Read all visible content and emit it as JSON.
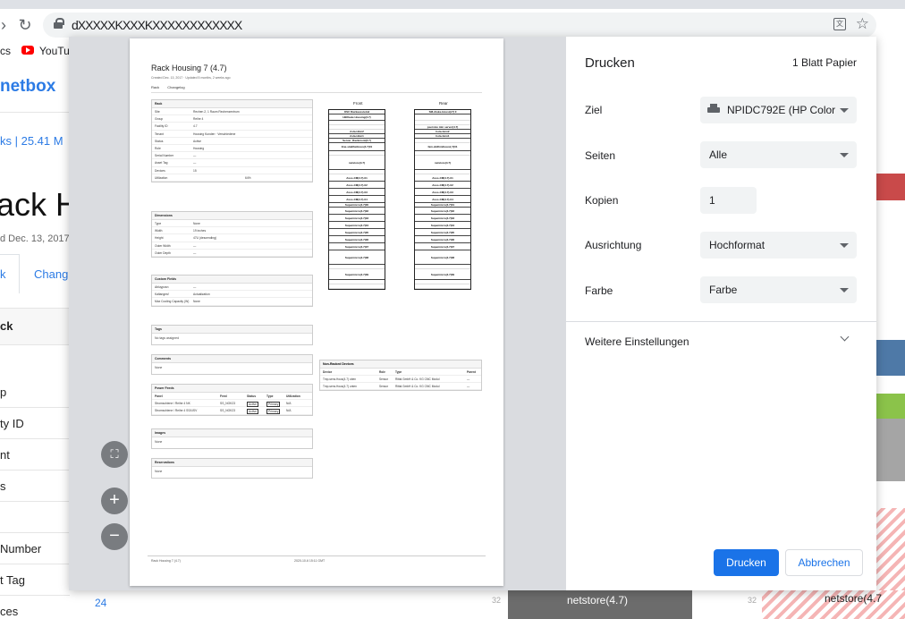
{
  "browser": {
    "url": "dXXXXXKXXXKXXXXXXXXXXXX",
    "bookmarks": [
      "cs",
      "YouTub"
    ]
  },
  "background": {
    "brand": "netbox",
    "breadcrumb": "ks  |  25.41 M",
    "title": "ack Ho",
    "subtitle": "d Dec. 13, 2017 ·",
    "tab_rack": "k",
    "tab_changelog": "Chang",
    "panel_title": "ck",
    "rows": [
      "p",
      "ty ID",
      "nt",
      "s",
      "",
      "Number",
      "t Tag",
      "ces"
    ],
    "row_value": "24",
    "bottom_num1": "32",
    "bottom_block": "netstore(4.7)",
    "bottom_num2": "32",
    "bottom_stripe": "netstore(4.7"
  },
  "dialog": {
    "title": "Drucken",
    "sheets": "1 Blatt Papier",
    "fields": {
      "destination_label": "Ziel",
      "destination_value": "NPIDC792E (HP Color",
      "pages_label": "Seiten",
      "pages_value": "Alle",
      "copies_label": "Kopien",
      "copies_value": "1",
      "orientation_label": "Ausrichtung",
      "orientation_value": "Hochformat",
      "color_label": "Farbe",
      "color_value": "Farbe"
    },
    "more_settings": "Weitere Einstellungen",
    "print_button": "Drucken",
    "cancel_button": "Abbrechen",
    "fit_icon": "fit-to-page-icon",
    "zoom_in": "+",
    "zoom_out": "−"
  },
  "preview": {
    "title": "Rack Housing 7 (4.7)",
    "subtitle": "Created Dec. 13, 2017 · Updated 5 months, 2 weeks ago",
    "tabs": [
      "Rack",
      "Changelog"
    ],
    "rack_panel": {
      "title": "Rack",
      "rows": [
        [
          "Site",
          "Rechen 2, 1 Raum Rechenzentrum",
          ""
        ],
        [
          "Group",
          "Reihe 4",
          ""
        ],
        [
          "Facility ID",
          "4.7",
          ""
        ],
        [
          "Tenant",
          "Housing Kunden · Verschiedene",
          ""
        ],
        [
          "Status",
          "Active",
          ""
        ],
        [
          "Role",
          "Housing",
          ""
        ],
        [
          "Serial Number",
          "—",
          ""
        ],
        [
          "Asset Tag",
          "—",
          ""
        ],
        [
          "Devices",
          "15",
          ""
        ],
        [
          "Utilization",
          "",
          "64%"
        ]
      ]
    },
    "dimensions_panel": {
      "title": "Dimensions",
      "rows": [
        [
          "Type",
          "None",
          ""
        ],
        [
          "Width",
          "19 inches",
          ""
        ],
        [
          "Height",
          "47U (descending)",
          ""
        ],
        [
          "Outer Width",
          "—",
          ""
        ],
        [
          "Outer Depth",
          "—",
          ""
        ]
      ]
    },
    "custom_panel": {
      "title": "Custom Fields",
      "rows": [
        [
          "Abluyposn",
          "—",
          ""
        ],
        [
          "Kaltangesf",
          "Actualization",
          ""
        ],
        [
          "Max Cooling Capacity (W)",
          "None",
          ""
        ]
      ]
    },
    "tags_panel": {
      "title": "Tags",
      "body": "No tags assigned"
    },
    "comments_panel": {
      "title": "Comments",
      "body": "None"
    },
    "power_panel": {
      "title": "Power Feeds",
      "headers": [
        "Panel",
        "Feed",
        "Status",
        "Type",
        "Utilization"
      ],
      "rows": [
        [
          "Stromschiene / Reihe 4 NK",
          "SS_NOK23",
          "Active",
          "Primary",
          "N/A"
        ],
        [
          "Stromschiene / Reihe 4 SS/USV",
          "SS_NOK23",
          "Active",
          "Primary",
          "N/A"
        ]
      ]
    },
    "images_panel": {
      "title": "Images",
      "body": "None"
    },
    "reservations_panel": {
      "title": "Reservations",
      "body": "None"
    },
    "front_label": "Front",
    "rear_label": "Rear",
    "front_units": [
      "OSC Rackaussteind",
      "HERsate Housing(4.7)",
      "",
      "",
      "Asla-Hmn2",
      "Asla-Hmn1",
      "Server_Rackmont(4.7)",
      "Ene-staBhsiHous(4.7)01",
      "",
      "netstore(4.7)",
      "",
      "Axos-CM(4.7)-01",
      "Axos-CM(4.7)-02",
      "Axos-CM(4.7)-03",
      "Axos-CM(4.7)-04",
      "Supermicro(4.7)00",
      "Supermicro(4.7)02",
      "Supermicro(4.7)03",
      "Supermicro(4.7)04",
      "Supermicro(4.7)05",
      "Supermicro(4.7)06",
      "Supermicro(4.7)07",
      "Supermicro(4.7)08",
      "",
      "Supermicro(4.7)09",
      "",
      ""
    ],
    "rear_units": [
      "SM-druke-Housi(c7) 0",
      "",
      "",
      "pservice mtn server(4.7)",
      "hola-hmn2",
      "hola-hmn1",
      "",
      "fam-dollhmihousi(-7)01",
      "",
      "netstore(4.7)",
      "",
      "Axos-CM(4.7)-01",
      "Axos-CM(4.7)-02",
      "Axos-CM(4.7)-03",
      "Axos-CM(4.7)-04",
      "Supermicro(4.7)01",
      "Supermicro(4.7)02",
      "Supermicro(4.7)03",
      "Supermicro(4.7)04",
      "Supermicro(4.7)05",
      "Supermicro(4.7)06",
      "Supermicro(4.7)07",
      "Supermicro(4.7)08",
      "",
      "Supermicro(4.7)09",
      "",
      ""
    ],
    "non_racked": {
      "title": "Non-Racked Devices",
      "headers": [
        "Device",
        "Role",
        "Type",
        "Parent"
      ],
      "rows": [
        [
          "Tmp-sens.Hous(4.7) oben",
          "Sensor",
          "Rittal GmbH & Co. KG CMC Modul",
          "—"
        ],
        [
          "Tmp-sens.Hous(4.7) unten",
          "Sensor",
          "Rittal GmbH & Co. KG CMC Modul",
          "—"
        ]
      ]
    },
    "footer_left": "Rack Housing 7 (4.7)",
    "footer_right": "2020-10-6 15:11 GMT"
  },
  "colors": {
    "accent": "#1a73e8",
    "netbox_blue": "#2c7be5",
    "preview_bg": "#dadce0"
  }
}
